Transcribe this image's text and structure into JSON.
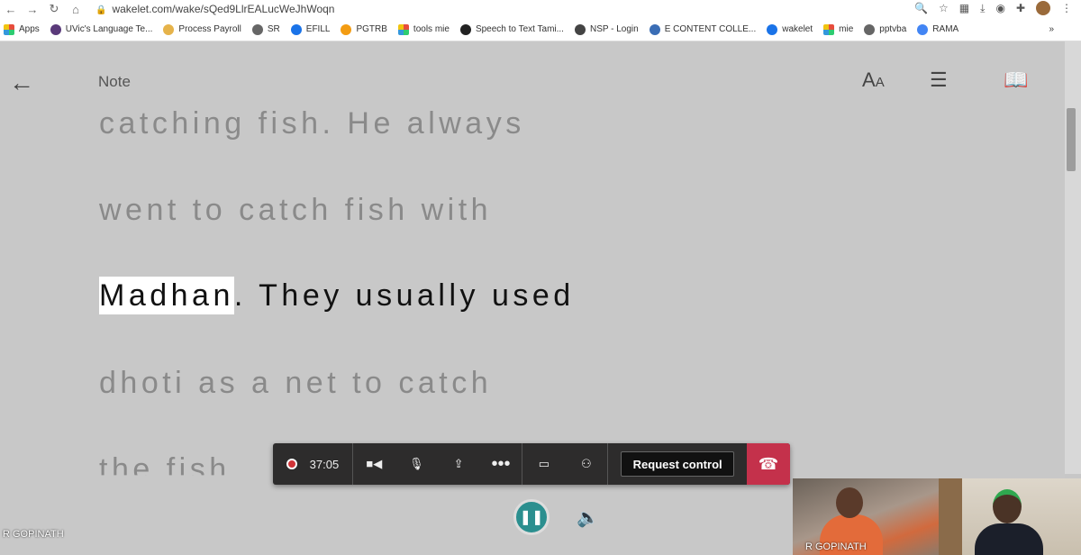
{
  "browser": {
    "url": "wakelet.com/wake/sQed9LlrEALucWeJhWoqn",
    "bookmarks": [
      {
        "label": "Apps",
        "icon": "apps-grid-icon",
        "color": "#e74c3c"
      },
      {
        "label": "UVic's Language Te...",
        "icon": "uvic-icon",
        "color": "#5a3a7a"
      },
      {
        "label": "Process Payroll",
        "icon": "payroll-icon",
        "color": "#e6b34a"
      },
      {
        "label": "SR",
        "icon": "globe-icon",
        "color": "#666666"
      },
      {
        "label": "EFILL",
        "icon": "efill-icon",
        "color": "#1a73e8"
      },
      {
        "label": "PGTRB",
        "icon": "pgtrb-icon",
        "color": "#f39c12"
      },
      {
        "label": "tools mie",
        "icon": "microsoft-icon",
        "color": "#3498db"
      },
      {
        "label": "Speech to Text Tami...",
        "icon": "speech-icon",
        "color": "#222222"
      },
      {
        "label": "NSP - Login",
        "icon": "nsp-icon",
        "color": "#444444"
      },
      {
        "label": "E CONTENT COLLE...",
        "icon": "econtent-icon",
        "color": "#3a6db5"
      },
      {
        "label": "wakelet",
        "icon": "wakelet-icon",
        "color": "#1a73e8"
      },
      {
        "label": "mie",
        "icon": "microsoft-icon",
        "color": "#3498db"
      },
      {
        "label": "pptvba",
        "icon": "globe-icon",
        "color": "#666666"
      },
      {
        "label": "RAMA",
        "icon": "google-icon",
        "color": "#4285f4"
      }
    ],
    "more_label": "»"
  },
  "reader": {
    "title": "Note",
    "lines": [
      "catching fish. He always",
      "went to catch fish with",
      "Madhan",
      ". They usually used",
      "dhoti as a net to catch",
      "the fish."
    ]
  },
  "call": {
    "timer": "37:05",
    "request_control_label": "Request control",
    "participant_left": "R GOPINATH",
    "participant_video": "R GOPINATH",
    "accent": "#c4314b",
    "share_color": "#2b8f8f"
  }
}
